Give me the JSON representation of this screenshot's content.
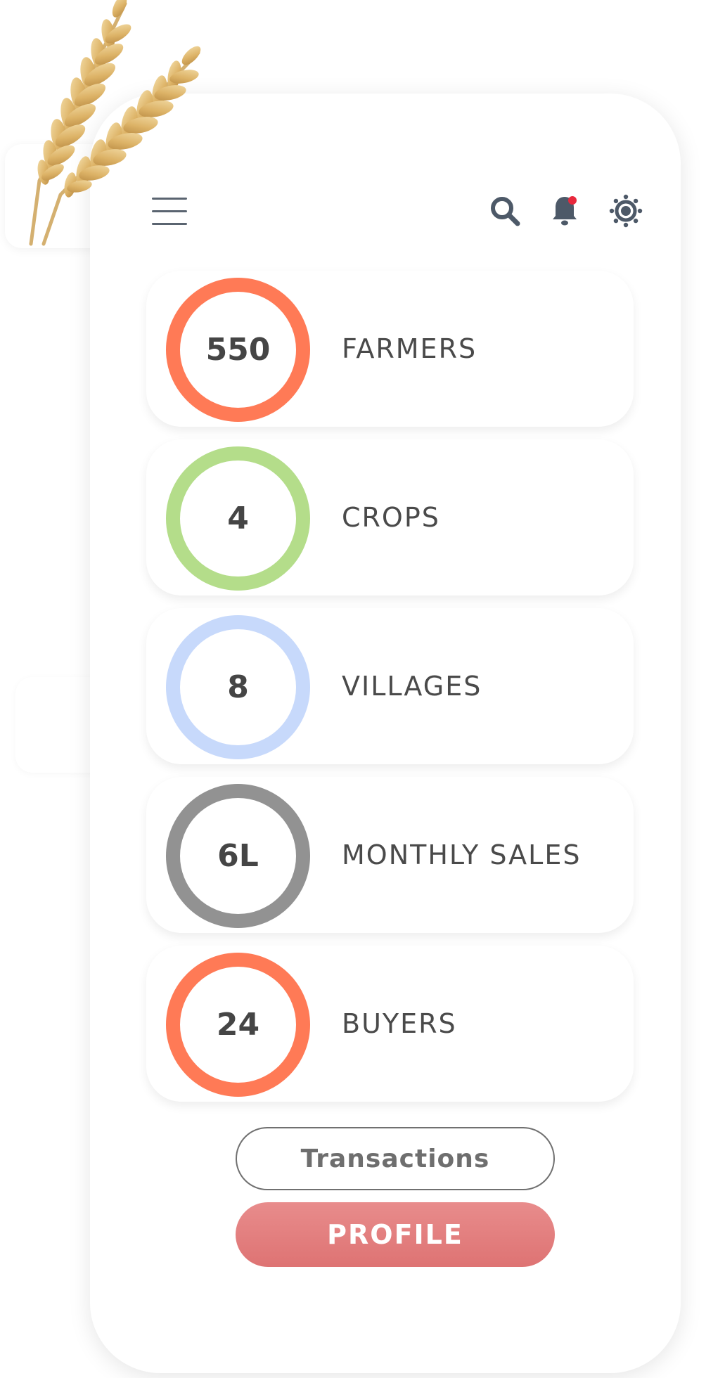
{
  "stats": [
    {
      "value": "550",
      "label": "FARMERS",
      "ring_color": "#ff7a56"
    },
    {
      "value": "4",
      "label": "CROPS",
      "ring_color": "#b4dd8a"
    },
    {
      "value": "8",
      "label": "VILLAGES",
      "ring_color": "#c7d9fb"
    },
    {
      "value": "6L",
      "label": "MONTHLY SALES",
      "ring_color": "#929292"
    },
    {
      "value": "24",
      "label": "BUYERS",
      "ring_color": "#ff7a56"
    }
  ],
  "buttons": {
    "transactions": "Transactions",
    "profile": "PROFILE"
  },
  "header": {
    "icons": [
      "menu-icon",
      "search-icon",
      "bell-icon",
      "gear-icon"
    ],
    "notification_color": "#e8283c"
  },
  "colors": {
    "icon": "#4d5968",
    "primary_button": "#e07a7a",
    "label": "#4a4a4a"
  }
}
